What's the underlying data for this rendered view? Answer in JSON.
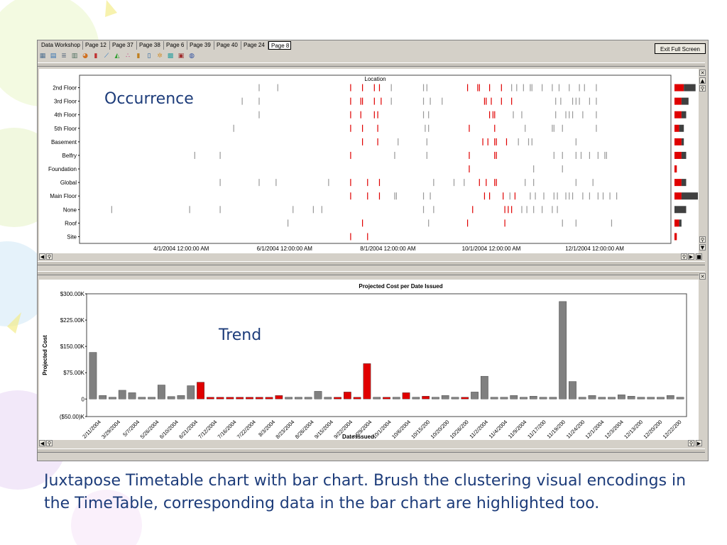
{
  "tabs": [
    "Data Workshop",
    "Page 12",
    "Page 37",
    "Page 38",
    "Page 6",
    "Page 39",
    "Page 40",
    "Page 24",
    "Page 8"
  ],
  "active_tab": "Page 8",
  "exit_button": "Exit Full Screen",
  "toolbar_icons": [
    "table-icon",
    "grid-icon",
    "list-icon",
    "report-icon",
    "pie-icon",
    "bar-icon",
    "line-icon",
    "area-icon",
    "scatter-icon",
    "stacked-bar-icon",
    "column-icon",
    "network-icon",
    "heatmap-icon",
    "treemap-icon",
    "globe-icon"
  ],
  "annotations": {
    "occurrence": "Occurrence",
    "trend": "Trend"
  },
  "caption": "Juxtapose Timetable chart with bar chart. Brush the clustering visual encodings in the TimeTable, corresponding data in the bar chart are highlighted too.",
  "colors": {
    "highlight": "#e00000",
    "normal": "#808080",
    "dark_bar": "#404040",
    "accent_text": "#1d3c7a"
  },
  "chart_data": [
    {
      "type": "timetable",
      "title": "Location",
      "rows": [
        "2nd Floor",
        "3rd Floor",
        "4th Floor",
        "5th Floor",
        "Basement",
        "Belfry",
        "Foundation",
        "Global",
        "Main Floor",
        "None",
        "Roof",
        "Site"
      ],
      "x_ticks": [
        "4/1/2004 12:00:00 AM",
        "6/1/2004 12:00:00 AM",
        "8/1/2004 12:00:00 AM",
        "10/1/2004 12:00:00 AM",
        "12/1/2004 12:00:00 AM"
      ],
      "x_range": [
        "2004-02-01",
        "2005-01-15"
      ],
      "events": {
        "2nd Floor": [
          [
            "2004-05-17",
            "n"
          ],
          [
            "2004-05-28",
            "n"
          ],
          [
            "2004-07-10",
            "h"
          ],
          [
            "2004-07-17",
            "h"
          ],
          [
            "2004-07-24",
            "h"
          ],
          [
            "2004-07-27",
            "h"
          ],
          [
            "2004-08-03",
            "n"
          ],
          [
            "2004-08-22",
            "n"
          ],
          [
            "2004-08-24",
            "n"
          ],
          [
            "2004-09-17",
            "h"
          ],
          [
            "2004-09-23",
            "h"
          ],
          [
            "2004-09-24",
            "h"
          ],
          [
            "2004-09-30",
            "h"
          ],
          [
            "2004-10-07",
            "h"
          ],
          [
            "2004-10-13",
            "n"
          ],
          [
            "2004-10-16",
            "n"
          ],
          [
            "2004-10-20",
            "n"
          ],
          [
            "2004-10-24",
            "n"
          ],
          [
            "2004-10-25",
            "n"
          ],
          [
            "2004-10-31",
            "n"
          ],
          [
            "2004-11-06",
            "n"
          ],
          [
            "2004-11-10",
            "n"
          ],
          [
            "2004-11-16",
            "n"
          ],
          [
            "2004-11-22",
            "n"
          ],
          [
            "2004-11-25",
            "n"
          ],
          [
            "2004-12-02",
            "n"
          ]
        ],
        "3rd Floor": [
          [
            "2004-05-07",
            "n"
          ],
          [
            "2004-05-17",
            "n"
          ],
          [
            "2004-07-10",
            "h"
          ],
          [
            "2004-07-16",
            "h"
          ],
          [
            "2004-07-17",
            "h"
          ],
          [
            "2004-07-24",
            "h"
          ],
          [
            "2004-07-28",
            "h"
          ],
          [
            "2004-08-03",
            "n"
          ],
          [
            "2004-08-22",
            "n"
          ],
          [
            "2004-08-26",
            "n"
          ],
          [
            "2004-09-02",
            "n"
          ],
          [
            "2004-09-27",
            "h"
          ],
          [
            "2004-09-28",
            "h"
          ],
          [
            "2004-10-01",
            "h"
          ],
          [
            "2004-10-07",
            "h"
          ],
          [
            "2004-10-13",
            "h"
          ],
          [
            "2004-11-08",
            "n"
          ],
          [
            "2004-11-11",
            "n"
          ],
          [
            "2004-11-18",
            "n"
          ],
          [
            "2004-11-20",
            "n"
          ],
          [
            "2004-11-22",
            "n"
          ],
          [
            "2004-11-28",
            "n"
          ],
          [
            "2004-12-02",
            "n"
          ]
        ],
        "4th Floor": [
          [
            "2004-05-17",
            "n"
          ],
          [
            "2004-07-10",
            "h"
          ],
          [
            "2004-07-16",
            "h"
          ],
          [
            "2004-07-24",
            "h"
          ],
          [
            "2004-07-26",
            "h"
          ],
          [
            "2004-08-22",
            "n"
          ],
          [
            "2004-08-25",
            "n"
          ],
          [
            "2004-09-30",
            "h"
          ],
          [
            "2004-10-02",
            "h"
          ],
          [
            "2004-10-03",
            "h"
          ],
          [
            "2004-10-14",
            "n"
          ],
          [
            "2004-10-19",
            "n"
          ],
          [
            "2004-11-08",
            "n"
          ],
          [
            "2004-11-14",
            "n"
          ],
          [
            "2004-11-16",
            "n"
          ],
          [
            "2004-11-18",
            "n"
          ],
          [
            "2004-11-24",
            "n"
          ],
          [
            "2004-12-02",
            "n"
          ]
        ],
        "5th Floor": [
          [
            "2004-05-02",
            "n"
          ],
          [
            "2004-07-10",
            "h"
          ],
          [
            "2004-07-17",
            "h"
          ],
          [
            "2004-07-26",
            "h"
          ],
          [
            "2004-08-23",
            "n"
          ],
          [
            "2004-08-25",
            "n"
          ],
          [
            "2004-09-18",
            "h"
          ],
          [
            "2004-10-03",
            "h"
          ],
          [
            "2004-10-21",
            "n"
          ],
          [
            "2004-11-06",
            "n"
          ],
          [
            "2004-11-07",
            "n"
          ],
          [
            "2004-11-12",
            "n"
          ],
          [
            "2004-12-02",
            "n"
          ]
        ],
        "Basement": [
          [
            "2004-07-17",
            "h"
          ],
          [
            "2004-07-26",
            "h"
          ],
          [
            "2004-08-07",
            "n"
          ],
          [
            "2004-08-24",
            "n"
          ],
          [
            "2004-09-26",
            "h"
          ],
          [
            "2004-09-29",
            "h"
          ],
          [
            "2004-10-03",
            "h"
          ],
          [
            "2004-10-04",
            "h"
          ],
          [
            "2004-10-10",
            "h"
          ],
          [
            "2004-10-17",
            "n"
          ],
          [
            "2004-10-23",
            "n"
          ],
          [
            "2004-10-25",
            "n"
          ],
          [
            "2004-11-20",
            "n"
          ]
        ],
        "Belfry": [
          [
            "2004-04-09",
            "n"
          ],
          [
            "2004-04-24",
            "n"
          ],
          [
            "2004-07-10",
            "h"
          ],
          [
            "2004-08-05",
            "n"
          ],
          [
            "2004-08-24",
            "n"
          ],
          [
            "2004-09-18",
            "h"
          ],
          [
            "2004-10-03",
            "h"
          ],
          [
            "2004-10-04",
            "h"
          ],
          [
            "2004-11-07",
            "n"
          ],
          [
            "2004-11-12",
            "n"
          ],
          [
            "2004-11-20",
            "n"
          ],
          [
            "2004-11-23",
            "n"
          ],
          [
            "2004-11-28",
            "n"
          ],
          [
            "2004-12-03",
            "n"
          ],
          [
            "2004-12-07",
            "n"
          ],
          [
            "2004-12-08",
            "n"
          ]
        ],
        "Foundation": [
          [
            "2004-09-18",
            "h"
          ],
          [
            "2004-10-26",
            "n"
          ],
          [
            "2004-11-12",
            "n"
          ]
        ],
        "Global": [
          [
            "2004-04-24",
            "n"
          ],
          [
            "2004-05-17",
            "n"
          ],
          [
            "2004-05-27",
            "n"
          ],
          [
            "2004-06-27",
            "n"
          ],
          [
            "2004-07-10",
            "h"
          ],
          [
            "2004-07-20",
            "h"
          ],
          [
            "2004-07-27",
            "h"
          ],
          [
            "2004-08-28",
            "n"
          ],
          [
            "2004-09-09",
            "n"
          ],
          [
            "2004-09-15",
            "n"
          ],
          [
            "2004-09-24",
            "h"
          ],
          [
            "2004-09-28",
            "h"
          ],
          [
            "2004-10-03",
            "h"
          ],
          [
            "2004-10-04",
            "h"
          ],
          [
            "2004-10-21",
            "n"
          ],
          [
            "2004-10-26",
            "n"
          ],
          [
            "2004-11-20",
            "n"
          ],
          [
            "2004-11-30",
            "n"
          ]
        ],
        "Main Floor": [
          [
            "2004-07-10",
            "h"
          ],
          [
            "2004-07-20",
            "h"
          ],
          [
            "2004-07-27",
            "h"
          ],
          [
            "2004-08-05",
            "n"
          ],
          [
            "2004-08-06",
            "n"
          ],
          [
            "2004-08-22",
            "n"
          ],
          [
            "2004-08-26",
            "n"
          ],
          [
            "2004-09-27",
            "h"
          ],
          [
            "2004-09-30",
            "h"
          ],
          [
            "2004-10-08",
            "h"
          ],
          [
            "2004-10-12",
            "n"
          ],
          [
            "2004-10-15",
            "h"
          ],
          [
            "2004-10-24",
            "n"
          ],
          [
            "2004-10-27",
            "n"
          ],
          [
            "2004-11-01",
            "n"
          ],
          [
            "2004-11-07",
            "n"
          ],
          [
            "2004-11-09",
            "n"
          ],
          [
            "2004-11-14",
            "n"
          ],
          [
            "2004-11-16",
            "n"
          ],
          [
            "2004-11-18",
            "n"
          ],
          [
            "2004-11-24",
            "n"
          ],
          [
            "2004-11-28",
            "n"
          ],
          [
            "2004-12-03",
            "n"
          ],
          [
            "2004-12-06",
            "n"
          ],
          [
            "2004-12-10",
            "n"
          ],
          [
            "2004-12-14",
            "n"
          ]
        ],
        "None": [
          [
            "2004-02-20",
            "n"
          ],
          [
            "2004-04-06",
            "n"
          ],
          [
            "2004-04-24",
            "n"
          ],
          [
            "2004-06-06",
            "n"
          ],
          [
            "2004-06-18",
            "n"
          ],
          [
            "2004-06-23",
            "n"
          ],
          [
            "2004-08-22",
            "n"
          ],
          [
            "2004-08-28",
            "n"
          ],
          [
            "2004-09-20",
            "h"
          ],
          [
            "2004-10-09",
            "h"
          ],
          [
            "2004-10-11",
            "h"
          ],
          [
            "2004-10-13",
            "h"
          ],
          [
            "2004-10-19",
            "n"
          ],
          [
            "2004-10-22",
            "n"
          ],
          [
            "2004-10-26",
            "n"
          ],
          [
            "2004-10-31",
            "n"
          ],
          [
            "2004-11-06",
            "n"
          ],
          [
            "2004-11-09",
            "n"
          ]
        ],
        "Roof": [
          [
            "2004-06-03",
            "n"
          ],
          [
            "2004-07-17",
            "h"
          ],
          [
            "2004-08-25",
            "n"
          ],
          [
            "2004-09-17",
            "h"
          ],
          [
            "2004-10-09",
            "h"
          ],
          [
            "2004-11-12",
            "n"
          ],
          [
            "2004-11-20",
            "n"
          ],
          [
            "2004-12-11",
            "n"
          ]
        ],
        "Site": [
          [
            "2004-07-10",
            "h"
          ],
          [
            "2004-07-20",
            "h"
          ]
        ]
      },
      "row_totals": [
        {
          "highlight": 4,
          "normal": 5
        },
        {
          "highlight": 3,
          "normal": 3
        },
        {
          "highlight": 3,
          "normal": 2
        },
        {
          "highlight": 2,
          "normal": 2
        },
        {
          "highlight": 3,
          "normal": 1
        },
        {
          "highlight": 3,
          "normal": 2
        },
        {
          "highlight": 1,
          "normal": 0
        },
        {
          "highlight": 3,
          "normal": 2
        },
        {
          "highlight": 3,
          "normal": 7
        },
        {
          "highlight": 0,
          "normal": 5
        },
        {
          "highlight": 2,
          "normal": 1
        },
        {
          "highlight": 1,
          "normal": 0
        }
      ]
    },
    {
      "type": "bar",
      "title": "Projected Cost per  Date  Issued",
      "xlabel": "Date  Issued",
      "ylabel": "Projected Cost",
      "y_ticks": [
        "$300.00K",
        "$225.00K",
        "$150.00K",
        "$75.00K",
        "0",
        "($50.00)K"
      ],
      "ylim": [
        -50,
        300
      ],
      "x_tick_labels": [
        "2/11/2004",
        "3/29/2004",
        "5/7/2004",
        "5/26/2004",
        "6/10/2004",
        "6/21/2004",
        "7/12/2004",
        "7/16/2004",
        "7/22/2004",
        "8/3/2004",
        "8/23/2004",
        "8/26/2004",
        "9/15/2004",
        "9/22/2004",
        "9/29/2004",
        "10/1/2004",
        "10/6/2004",
        "10/15/200",
        "10/20/200",
        "10/26/200",
        "11/2/2004",
        "11/4/2004",
        "11/9/2004",
        "11/17/200",
        "11/19/200",
        "11/24/200",
        "12/1/2004",
        "12/3/2004",
        "12/13/200",
        "12/20/200",
        "12/22/200"
      ],
      "values": [
        133,
        10,
        5,
        25,
        18,
        5,
        5,
        40,
        7,
        10,
        38,
        48,
        5,
        5,
        5,
        5,
        5,
        5,
        5,
        10,
        5,
        5,
        5,
        22,
        5,
        5,
        20,
        5,
        101,
        5,
        5,
        5,
        18,
        5,
        8,
        5,
        10,
        5,
        5,
        20,
        65,
        5,
        5,
        10,
        5,
        8,
        5,
        5,
        278,
        50,
        5,
        10,
        5,
        5,
        12,
        8,
        5,
        5,
        5,
        10,
        5
      ],
      "highlighted": [
        11,
        12,
        13,
        14,
        15,
        16,
        17,
        18,
        19,
        25,
        26,
        27,
        28,
        30,
        32,
        34,
        38
      ]
    }
  ]
}
